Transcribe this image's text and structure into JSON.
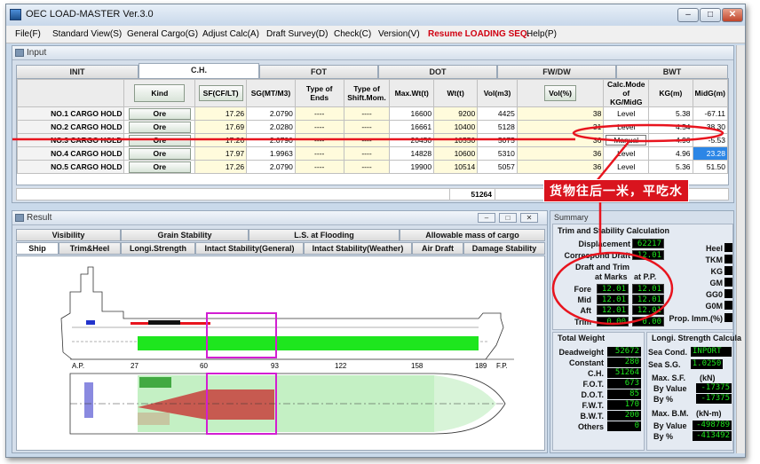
{
  "window": {
    "title": "OEC LOAD-MASTER Ver.3.0",
    "min": "–",
    "max": "□",
    "close": "✕"
  },
  "menu": [
    "File(F)",
    "Standard View(S)",
    "General Cargo(G)",
    "Adjust Calc(A)",
    "Draft Survey(D)",
    "Check(C)",
    "Version(V)",
    "Resume LOADING SEQ.",
    "Help(P)"
  ],
  "input": {
    "title": "Input",
    "tabs": [
      "INIT",
      "C.H.",
      "FOT",
      "DOT",
      "FW/DW",
      "BWT"
    ],
    "active_tab": "C.H.",
    "headers": {
      "kind": "Kind",
      "sf": "SF(CF/LT)",
      "sg": "SG(MT/M3)",
      "ends": "Type of Ends",
      "shift": "Type of Shift.Mom.",
      "maxwt": "Max.Wt(t)",
      "wt": "Wt(t)",
      "vol": "Vol(m3)",
      "volp": "Vol(%)",
      "calc": "Calc.Mode of KG/MidG",
      "kg": "KG(m)",
      "midg": "MidG(m)"
    },
    "rows": [
      {
        "name": "NO.1 CARGO HOLD",
        "kind": "Ore",
        "sf": "17.26",
        "sg": "2.0790",
        "ends": "----",
        "shift": "----",
        "maxwt": "16600",
        "wt": "9200",
        "vol": "4425",
        "volp": "38",
        "calc": "Level",
        "kg": "5.38",
        "midg": "-67.11"
      },
      {
        "name": "NO.2 CARGO HOLD",
        "kind": "Ore",
        "sf": "17.69",
        "sg": "2.0280",
        "ends": "----",
        "shift": "----",
        "maxwt": "16661",
        "wt": "10400",
        "vol": "5128",
        "volp": "31",
        "calc": "Level",
        "kg": "4.54",
        "midg": "-38.30"
      },
      {
        "name": "NO.3 CARGO HOLD",
        "kind": "Ore",
        "sf": "17.26",
        "sg": "2.0790",
        "ends": "----",
        "shift": "----",
        "maxwt": "20450",
        "wt": "10550",
        "vol": "5075",
        "volp": "36",
        "calc": "Manual",
        "kg": "4.96",
        "midg": "-5.53"
      },
      {
        "name": "NO.4 CARGO HOLD",
        "kind": "Ore",
        "sf": "17.97",
        "sg": "1.9963",
        "ends": "----",
        "shift": "----",
        "maxwt": "14828",
        "wt": "10600",
        "vol": "5310",
        "volp": "36",
        "calc": "Level",
        "kg": "4.96",
        "midg": "23.28"
      },
      {
        "name": "NO.5 CARGO HOLD",
        "kind": "Ore",
        "sf": "17.26",
        "sg": "2.0790",
        "ends": "----",
        "shift": "----",
        "maxwt": "19900",
        "wt": "10514",
        "vol": "5057",
        "volp": "36",
        "calc": "Level",
        "kg": "5.36",
        "midg": "51.50"
      }
    ],
    "total_wt": "51264"
  },
  "annotation": {
    "text": "货物往后一米，平吃水",
    "color": "#d9141e"
  },
  "result": {
    "title": "Result",
    "tabs_row1": [
      "Visibility",
      "Grain Stability",
      "L.S. at Flooding",
      "Allowable mass of cargo"
    ],
    "tabs_row2": [
      "Ship",
      "Trim&Heel",
      "Longi.Strength",
      "Intact Stability(General)",
      "Intact Stability(Weather)",
      "Air Draft",
      "Damage Stability"
    ],
    "active_tab": "Ship",
    "frame_labels": [
      "A.P.",
      "27",
      "60",
      "93",
      "122",
      "158",
      "189",
      "F.P."
    ]
  },
  "summary": {
    "title": "Summary",
    "trim_title": "Trim and Stability Calculation",
    "displacement_label": "Displacement",
    "displacement": "62217",
    "corr_draft_label": "Correspond Draft",
    "corr_draft": "12.01",
    "draft_title": "Draft and Trim",
    "at_marks": "at Marks",
    "at_pp": "at P.P.",
    "fore_label": "Fore",
    "fore_marks": "12.01",
    "fore_pp": "12.01",
    "mid_label": "Mid",
    "mid_marks": "12.01",
    "mid_pp": "12.01",
    "aft_label": "Aft",
    "aft_marks": "12.01",
    "aft_pp": "12.01",
    "trim_label": "Trim",
    "trim_marks": "0.00",
    "trim_pp": "0.00",
    "right_labels": [
      "Heel",
      "TKM",
      "KG",
      "GM",
      "GG0",
      "G0M",
      "Prop. Imm.(%)"
    ],
    "total_weight_title": "Total Weight",
    "weights": [
      {
        "label": "Deadweight",
        "value": "52672"
      },
      {
        "label": "Constant",
        "value": "280"
      },
      {
        "label": "C.H.",
        "value": "51264"
      },
      {
        "label": "F.O.T.",
        "value": "673"
      },
      {
        "label": "D.O.T.",
        "value": "85"
      },
      {
        "label": "F.W.T.",
        "value": "170"
      },
      {
        "label": "B.W.T.",
        "value": "200"
      },
      {
        "label": "Others",
        "value": "0"
      }
    ],
    "longi_title": "Longi. Strength Calcula",
    "sea_cond_label": "Sea Cond.",
    "sea_cond": "INPORT",
    "sea_sg_label": "Sea S.G.",
    "sea_sg": "1.0250",
    "max_sf_label": "Max. S.F.",
    "sf_unit": "(kN)",
    "by_value_label": "By Value",
    "sf_value": "-17375",
    "by_pct_label": "By %",
    "sf_pct": "-17375",
    "max_bm_label": "Max. B.M.",
    "bm_unit": "(kN-m)",
    "bm_value": "-498789",
    "bm_pct": "-413492"
  },
  "colors": {
    "highlight_red": "#e8141e",
    "selected_hold": "#d21ed2",
    "cargo_green": "#1ee61e",
    "led_text": "#1ee61e"
  }
}
